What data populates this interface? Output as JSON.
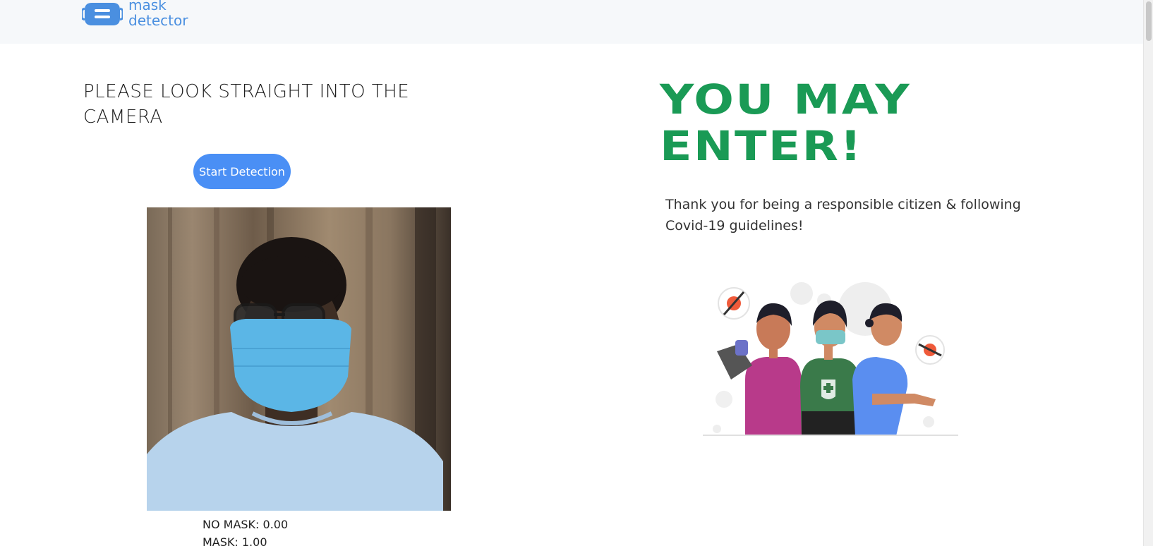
{
  "header": {
    "logo_icon": "mask-icon",
    "logo_line1": "mask",
    "logo_line2": "detector",
    "brand_color": "#4a8fe0"
  },
  "left": {
    "instruction": "PLEASE LOOK STRAIGHT INTO THE CAMERA",
    "start_button": "Start Detection",
    "button_color": "#4a8ff5",
    "no_mask_readout": "NO MASK: 0.00",
    "mask_readout": "MASK: 1.00"
  },
  "right": {
    "headline_line1": "YOU MAY",
    "headline_line2": "ENTER!",
    "headline_color": "#1a9a55",
    "message": "Thank you for being a responsible citizen & following Covid-19 guidelines!"
  }
}
